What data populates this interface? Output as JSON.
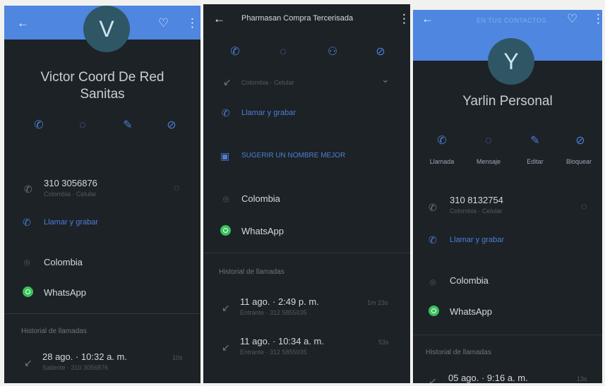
{
  "panel1": {
    "avatar_letter": "V",
    "name_line1": "Victor Coord De Red",
    "name_line2": "Sanitas",
    "phone": "310 3056876",
    "phone_sub": "Colombia · Celular",
    "call_record": "Llamar y grabar",
    "country": "Colombia",
    "whatsapp": "WhatsApp",
    "history_title": "Historial de llamadas",
    "history": [
      {
        "date": "28 ago. · 10:32 a. m.",
        "sub": "Saliente · 310 3056876",
        "dur": "10s"
      }
    ]
  },
  "panel2": {
    "title": "Pharmasan Compra Tercerisada",
    "location_sub": "Colombia · Celular",
    "call_record": "Llamar y grabar",
    "suggest": "SUGERIR UN NOMBRE MEJOR",
    "country": "Colombia",
    "whatsapp": "WhatsApp",
    "history_title": "Historial de llamadas",
    "history": [
      {
        "date": "11 ago. · 2:49 p. m.",
        "sub": "Entrante · 312 5855035",
        "dur": "1m 23s"
      },
      {
        "date": "11 ago. · 10:34 a. m.",
        "sub": "Entrante · 312 5855035",
        "dur": "53s"
      }
    ]
  },
  "panel3": {
    "header_text": "EN TUS CONTACTOS",
    "avatar_letter": "Y",
    "name": "Yarlin Personal",
    "actions": [
      "Llamada",
      "Mensaje",
      "Editar",
      "Bloquear"
    ],
    "phone": "310 8132754",
    "phone_sub": "Colombia · Celular",
    "call_record": "Llamar y grabar",
    "country": "Colombia",
    "whatsapp": "WhatsApp",
    "history_title": "Historial de llamadas",
    "history": [
      {
        "date": "05 ago. · 9:16 a. m.",
        "dur": "13s"
      }
    ]
  }
}
